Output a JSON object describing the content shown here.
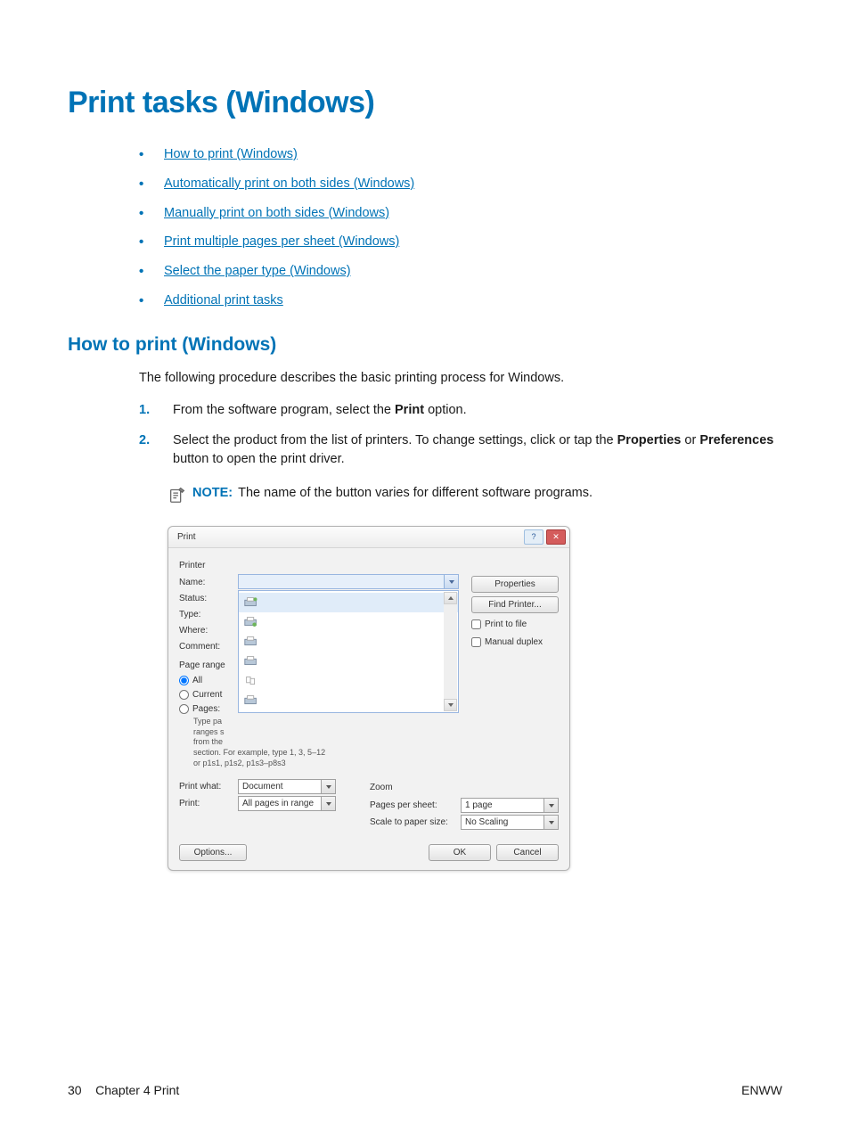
{
  "title": "Print tasks (Windows)",
  "links": [
    "How to print (Windows)",
    "Automatically print on both sides (Windows)",
    "Manually print on both sides (Windows)",
    "Print multiple pages per sheet (Windows)",
    "Select the paper type (Windows)",
    "Additional print tasks"
  ],
  "subtitle": "How to print (Windows)",
  "intro": "The following procedure describes the basic printing process for Windows.",
  "steps": {
    "s1a": "From the software program, select the ",
    "s1b": "Print",
    "s1c": " option.",
    "s2a": "Select the product from the list of printers. To change settings, click or tap the ",
    "s2b": "Properties",
    "s2c": " or ",
    "s2d": "Preferences",
    "s2e": " button to open the print driver."
  },
  "note": {
    "label": "NOTE:",
    "text": "The name of the button varies for different software programs."
  },
  "dialog": {
    "title": "Print",
    "printerSection": "Printer",
    "labels": {
      "name": "Name:",
      "status": "Status:",
      "type": "Type:",
      "where": "Where:",
      "comment": "Comment:"
    },
    "buttons": {
      "properties": "Properties",
      "findPrinter": "Find Printer..."
    },
    "checks": {
      "printToFile": "Print to file",
      "manualDuplex": "Manual duplex"
    },
    "rangeSection": "Page range",
    "range": {
      "all": "All",
      "current": "Current",
      "pages": "Pages:"
    },
    "rangeHint1": "Type pa",
    "rangeHint2": "ranges s",
    "rangeHint3": "from the",
    "rangeHint4": "section. For example, type 1, 3, 5–12",
    "rangeHint5": "or p1s1, p1s2, p1s3–p8s3",
    "printWhat": "Print what:",
    "printWhatValue": "Document",
    "printLbl": "Print:",
    "printValue": "All pages in range",
    "zoom": "Zoom",
    "pagesPerSheet": "Pages per sheet:",
    "pagesPerSheetValue": "1 page",
    "scaleLabel": "Scale to paper size:",
    "scaleValue": "No Scaling",
    "options": "Options...",
    "ok": "OK",
    "cancel": "Cancel"
  },
  "footer": {
    "page": "30",
    "chapter": "Chapter 4   Print",
    "enww": "ENWW"
  }
}
